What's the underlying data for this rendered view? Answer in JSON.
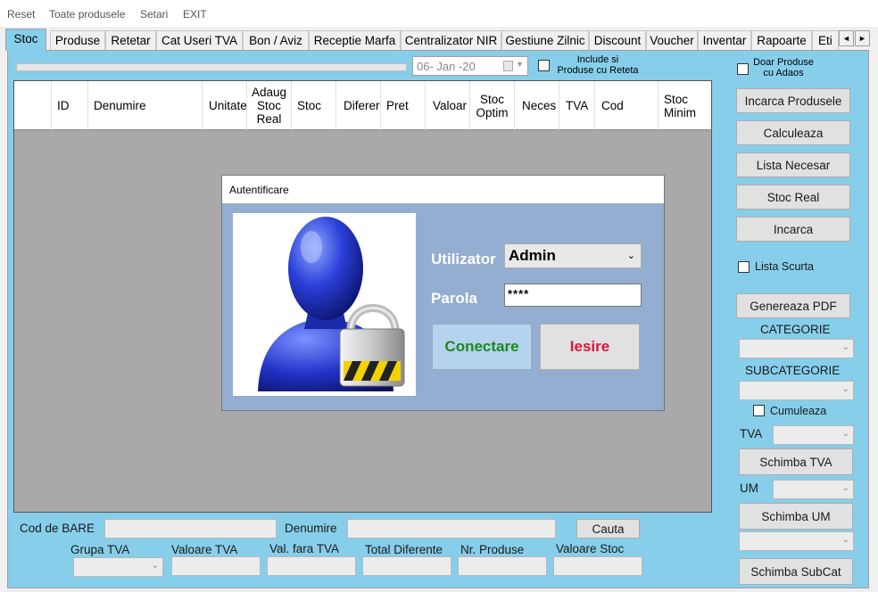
{
  "menu": {
    "reset": "Reset",
    "all_products": "Toate produsele",
    "settings": "Setari",
    "exit": "EXIT"
  },
  "tabs": [
    "Stoc",
    "Produse",
    "Retetar",
    "Cat Useri TVA",
    "Bon / Aviz",
    "Receptie Marfa",
    "Centralizator NIR",
    "Gestiune Zilnic",
    "Discount",
    "Voucher",
    "Inventar",
    "Rapoarte",
    "Eti"
  ],
  "tab_scroll": {
    "left": "◄",
    "right": "►"
  },
  "progress_fraction": 0,
  "date": {
    "value": "06- Jan -20",
    "chevron": "▼"
  },
  "include_reteta": "Include si\nProduse cu Reteta",
  "doar_adaos": "Doar Produse\ncu Adaos",
  "grid": {
    "columns": [
      "ID",
      "Denumire",
      "Unitate",
      "Adaug\nStoc\nReal",
      "Stoc",
      "Diferer",
      "Pret",
      "Valoar",
      "Stoc\nOptim",
      "Neces",
      "TVA",
      "Cod",
      "Stoc\nMinim"
    ]
  },
  "dialog": {
    "title": "Autentificare",
    "user_label": "Utilizator",
    "user_value": "Admin",
    "password_label": "Parola",
    "password_value": "****",
    "connect_label": "Conectare",
    "exit_label": "Iesire",
    "chevron": "⌄"
  },
  "right": {
    "incarca_produsele": "Incarca Produsele",
    "calculeaza": "Calculeaza",
    "lista_necesar": "Lista Necesar",
    "stoc_real": "Stoc Real",
    "incarca": "Incarca",
    "lista_scurta": "Lista Scurta",
    "genereaza_pdf": "Genereaza PDF",
    "categorie": "CATEGORIE",
    "subcategorie": "SUBCATEGORIE",
    "cumuleaza": "Cumuleaza",
    "tva": "TVA",
    "schimba_tva": "Schimba TVA",
    "um": "UM",
    "schimba_um": "Schimba UM",
    "schimba_subcat": "Schimba SubCat",
    "chevron": "⌄"
  },
  "bottom": {
    "cod_bare": "Cod de BARE",
    "denumire": "Denumire",
    "cauta": "Cauta",
    "grupa_tva": "Grupa TVA",
    "valoare_tva": "Valoare TVA",
    "val_fara_tva": "Val. fara TVA",
    "total_diferente": "Total Diferente",
    "nr_produse": "Nr. Produse",
    "valoare_stoc": "Valoare Stoc"
  },
  "colors": {
    "panel": "#87ceeb",
    "dialog_bg": "#93aed0",
    "connect_btn": "#b5d2ee",
    "connect_text": "#1a8a1a",
    "exit_text": "#dc143c"
  },
  "icons": [
    "user-lock-icon",
    "calendar-icon",
    "chevron-down-icon",
    "scroll-left-icon",
    "scroll-right-icon"
  ]
}
